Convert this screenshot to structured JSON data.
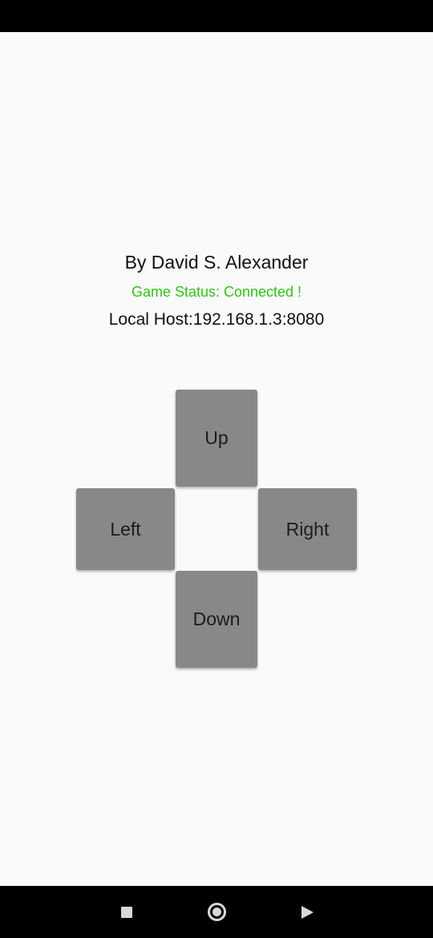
{
  "header": {
    "author": "By David S. Alexander",
    "game_status": "Game Status: Connected !",
    "local_host": "Local Host:192.168.1.3:8080"
  },
  "colors": {
    "status_connected": "#33c11a",
    "button_bg": "#888888",
    "background": "#fafafa"
  },
  "dpad": {
    "up": "Up",
    "left": "Left",
    "right": "Right",
    "down": "Down"
  },
  "nav_bar": {
    "recents_icon": "square-icon",
    "home_icon": "circle-icon",
    "back_icon": "triangle-icon"
  }
}
